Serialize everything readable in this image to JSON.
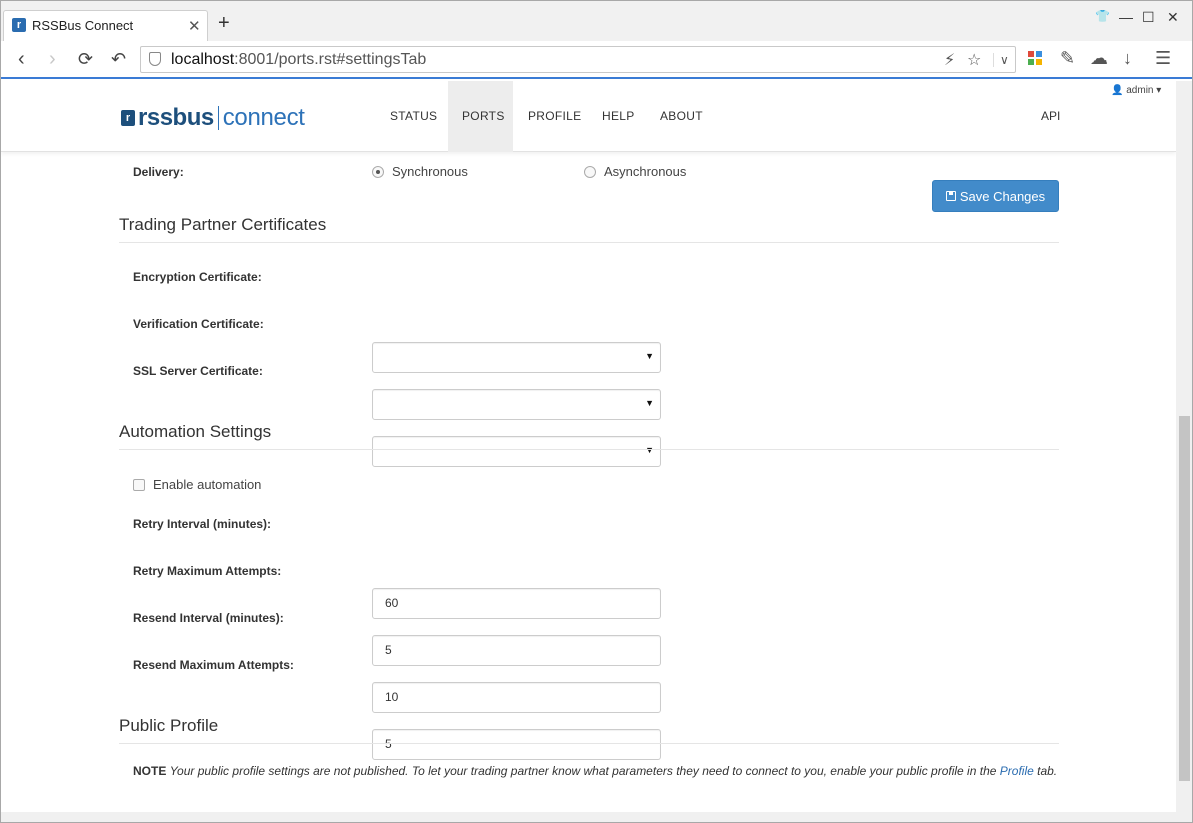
{
  "browser": {
    "tab_title": "RSSBus Connect",
    "tab_favicon": "rssbus-favicon",
    "address": {
      "host": "localhost",
      "rest": ":8001/ports.rst#settingsTab"
    }
  },
  "navbar": {
    "logo_rss": "rssbus",
    "logo_connect": "connect",
    "items": [
      "STATUS",
      "PORTS",
      "PROFILE",
      "HELP",
      "ABOUT"
    ],
    "active": "PORTS",
    "api": "API",
    "user": "admin"
  },
  "delivery": {
    "label": "Delivery:",
    "options": [
      "Synchronous",
      "Asynchronous"
    ],
    "selected": "Synchronous"
  },
  "save_button": "Save Changes",
  "certificates": {
    "title": "Trading Partner Certificates",
    "encryption_label": "Encryption Certificate:",
    "verification_label": "Verification Certificate:",
    "ssl_label": "SSL Server Certificate:"
  },
  "automation": {
    "title": "Automation Settings",
    "enable_label": "Enable automation",
    "enabled": false,
    "retry_interval_label": "Retry Interval (minutes):",
    "retry_interval": "60",
    "retry_max_label": "Retry Maximum Attempts:",
    "retry_max": "5",
    "resend_interval_label": "Resend Interval (minutes):",
    "resend_interval": "10",
    "resend_max_label": "Resend Maximum Attempts:",
    "resend_max": "5"
  },
  "public_profile": {
    "title": "Public Profile",
    "note_label": "NOTE",
    "note_text": "Your public profile settings are not published. To let your trading partner know what parameters they need to connect to you, enable your public profile in the",
    "note_link": "Profile",
    "note_tail": "tab."
  }
}
